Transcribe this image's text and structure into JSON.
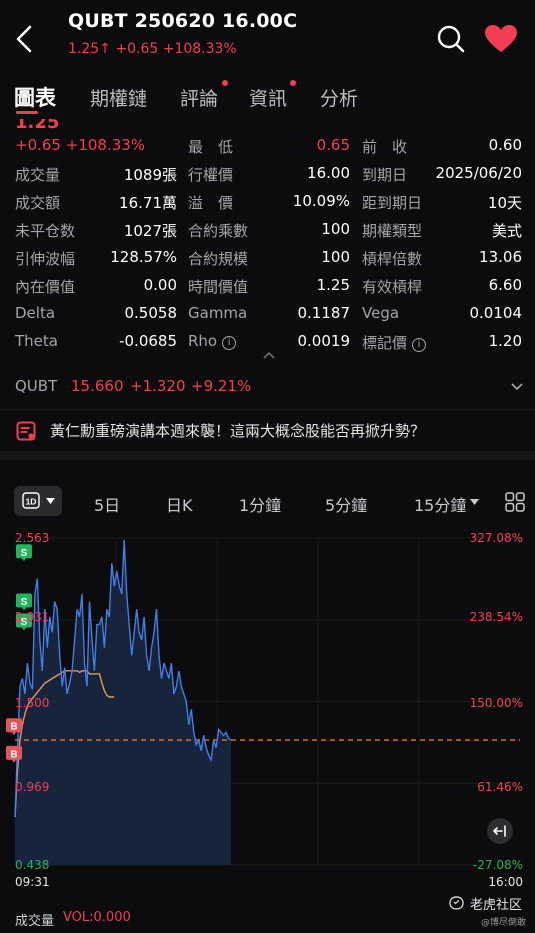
{
  "header": {
    "title": "QUBT 250620 16.00C",
    "price": "1.25",
    "price_arrow": "↑",
    "change": "+0.65",
    "change_pct": "+108.33%"
  },
  "tabs": [
    {
      "label": "圖表",
      "active": true,
      "badge": false
    },
    {
      "label": "期權鏈",
      "active": false,
      "badge": false
    },
    {
      "label": "評論",
      "active": false,
      "badge": true
    },
    {
      "label": "資訊",
      "active": false,
      "badge": true
    },
    {
      "label": "分析",
      "active": false,
      "badge": false
    }
  ],
  "summary": {
    "price_partial": "1.25",
    "change": "+0.65",
    "change_pct": "+108.33%"
  },
  "stats": {
    "low_label": "最　低",
    "low_value": "0.65",
    "prev_close_label": "前　收",
    "prev_close_value": "0.60",
    "rows": [
      {
        "l1": "成交量",
        "v1": "1089張",
        "l2": "行權價",
        "v2": "16.00",
        "l3": "到期日",
        "v3": "2025/06/20",
        "i2": false,
        "i3": false
      },
      {
        "l1": "成交額",
        "v1": "16.71萬",
        "l2": "溢　價",
        "v2": "10.09%",
        "l3": "距到期日",
        "v3": "10天",
        "i2": false,
        "i3": false
      },
      {
        "l1": "未平仓数",
        "v1": "1027張",
        "l2": "合約乘數",
        "v2": "100",
        "l3": "期權類型",
        "v3": "美式",
        "i2": false,
        "i3": false
      },
      {
        "l1": "引伸波幅",
        "v1": "128.57%",
        "l2": "合約規模",
        "v2": "100",
        "l3": "槓桿倍數",
        "v3": "13.06",
        "i2": false,
        "i3": false
      },
      {
        "l1": "內在價值",
        "v1": "0.00",
        "l2": "時間價值",
        "v2": "1.25",
        "l3": "有效槓桿",
        "v3": "6.60",
        "i2": false,
        "i3": false
      },
      {
        "l1": "Delta",
        "v1": "0.5058",
        "l2": "Gamma",
        "v2": "0.1187",
        "l3": "Vega",
        "v3": "0.0104",
        "i2": false,
        "i3": false
      },
      {
        "l1": "Theta",
        "v1": "-0.0685",
        "l2": "Rho",
        "v2": "0.0019",
        "l3": "標記價",
        "v3": "1.20",
        "i2": true,
        "i3": true
      }
    ]
  },
  "underlying": {
    "symbol": "QUBT",
    "price": "15.660",
    "change": "+1.320",
    "change_pct": "+9.21%"
  },
  "news": {
    "text": "黃仁勳重磅演講本週來襲！這兩大概念股能否再掀升勢？"
  },
  "chart_tabs": {
    "active": "1D",
    "items": [
      "5日",
      "日K",
      "1分鐘",
      "5分鐘",
      "15分鐘"
    ]
  },
  "chart_data": {
    "type": "line",
    "y_left_labels": [
      "2.563",
      "2.031",
      "1.500",
      "0.969",
      "0.438"
    ],
    "y_right_labels": [
      "327.08%",
      "238.54%",
      "150.00%",
      "61.46%",
      "-27.08%"
    ],
    "x_labels": [
      "09:31",
      "16:00"
    ],
    "ylim": [
      0.438,
      2.563
    ],
    "prev_close": 1.25,
    "series": [
      {
        "values": [
          0.75,
          1.2,
          1.6,
          1.65,
          1.55,
          1.75,
          1.62,
          1.58,
          2.2,
          2.3,
          1.9,
          1.7,
          2.1,
          1.85,
          2.05,
          1.95,
          2.15,
          2.1,
          1.8,
          1.6,
          1.72,
          1.55,
          1.62,
          1.7,
          1.9,
          2.1,
          2.05,
          2.2,
          1.75,
          1.6,
          2.15,
          1.9,
          1.7,
          2.0,
          2.0,
          2.05,
          1.85,
          2.1,
          2.05,
          2.4,
          2.25,
          2.35,
          2.25,
          2.2,
          2.55,
          2.2,
          2.0,
          1.8,
          1.95,
          2.1,
          1.95,
          1.9,
          2.05,
          1.8,
          1.7,
          1.85,
          1.95,
          2.1,
          1.8,
          1.65,
          1.75,
          1.7,
          1.65,
          1.75,
          1.55,
          1.6,
          1.7,
          1.6,
          1.55,
          1.5,
          1.35,
          1.45,
          1.3,
          1.22,
          1.25,
          1.18,
          1.28,
          1.2,
          1.15,
          1.12,
          1.25,
          1.2,
          1.32,
          1.3,
          1.28,
          1.3,
          1.26,
          1.25
        ],
        "color": "#3f7fe6"
      },
      {
        "values": [
          0.75,
          1.05,
          1.25,
          1.35,
          1.42,
          1.47,
          1.5,
          1.52,
          1.54,
          1.56,
          1.58,
          1.6,
          1.62,
          1.63,
          1.64,
          1.65,
          1.66,
          1.67,
          1.68,
          1.69,
          1.7,
          1.7,
          1.7,
          1.7,
          1.7,
          1.7,
          1.69,
          1.7,
          1.7,
          1.7,
          1.68,
          1.68,
          1.68,
          1.68,
          1.68,
          1.62,
          1.57,
          1.54,
          1.53,
          1.53,
          1.53
        ],
        "color": "#e39a60"
      }
    ],
    "markers": [
      {
        "label": "S",
        "value": 2.47,
        "index": 2,
        "color": "#22b35d"
      },
      {
        "label": "S",
        "value": 2.15,
        "index": 2,
        "color": "#22b35d"
      },
      {
        "label": "S",
        "value": 2.02,
        "index": 2,
        "color": "#22b35d"
      },
      {
        "label": "B",
        "value": 1.34,
        "index": 0,
        "color": "#e2555d"
      },
      {
        "label": "B",
        "value": 1.16,
        "index": 0,
        "color": "#e2555d"
      }
    ]
  },
  "volume": {
    "label": "成交量",
    "value": "VOL:0.000"
  },
  "watermark": {
    "brand": "老虎社区",
    "user": "@博尽倒敢"
  },
  "colors": {
    "red": "#f23d55",
    "green": "#22b35d",
    "blue": "#3f7fe6",
    "orange": "#e39a60",
    "bg": "#0c0c0e"
  }
}
